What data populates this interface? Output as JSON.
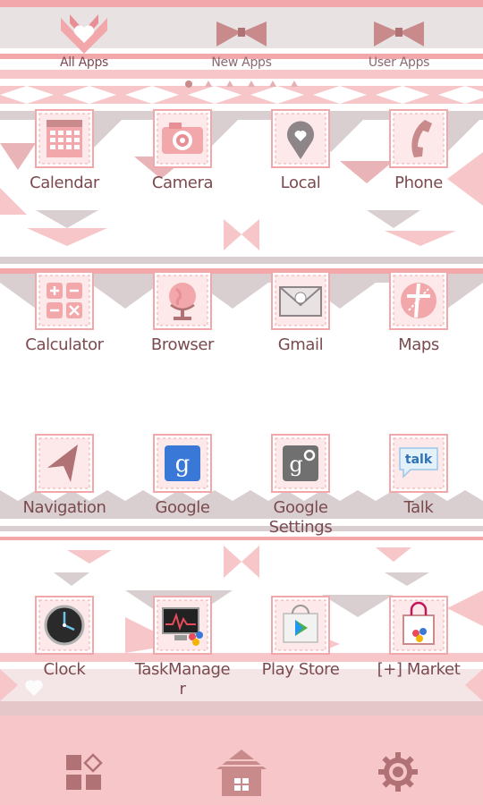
{
  "tabs": [
    {
      "label": "All Apps",
      "icon": "heart-bow-icon",
      "active": true
    },
    {
      "label": "New Apps",
      "icon": "bow-icon",
      "active": false
    },
    {
      "label": "User Apps",
      "icon": "bow-icon",
      "active": false
    }
  ],
  "page_indicator": {
    "total": 6,
    "current": 1
  },
  "apps": [
    {
      "label": "Calendar",
      "icon": "calendar-icon"
    },
    {
      "label": "Camera",
      "icon": "camera-icon"
    },
    {
      "label": "Local",
      "icon": "map-pin-heart-icon"
    },
    {
      "label": "Phone",
      "icon": "phone-icon"
    },
    {
      "label": "Calculator",
      "icon": "calculator-icon"
    },
    {
      "label": "Browser",
      "icon": "globe-icon"
    },
    {
      "label": "Gmail",
      "icon": "envelope-icon"
    },
    {
      "label": "Maps",
      "icon": "map-icon"
    },
    {
      "label": "Navigation",
      "icon": "navigation-arrow-icon"
    },
    {
      "label": "Google",
      "icon": "google-icon"
    },
    {
      "label": "Google Settings",
      "icon": "google-settings-icon"
    },
    {
      "label": "Talk",
      "icon": "talk-icon"
    },
    {
      "label": "Clock",
      "icon": "clock-icon"
    },
    {
      "label": "TaskManager",
      "icon": "task-manager-icon"
    },
    {
      "label": "Play Store",
      "icon": "play-store-icon"
    },
    {
      "label": "[+] Market",
      "icon": "market-bag-icon"
    }
  ],
  "dock": [
    {
      "name": "apps-grid",
      "icon": "apps-grid-icon"
    },
    {
      "name": "home",
      "icon": "home-house-icon"
    },
    {
      "name": "settings",
      "icon": "gear-icon"
    }
  ],
  "colors": {
    "pink": "#f2a8ab",
    "light_pink": "#f7c6c9",
    "gray": "#c9c0c2",
    "mauve": "#c98a8c",
    "text": "#7a4a4e"
  }
}
